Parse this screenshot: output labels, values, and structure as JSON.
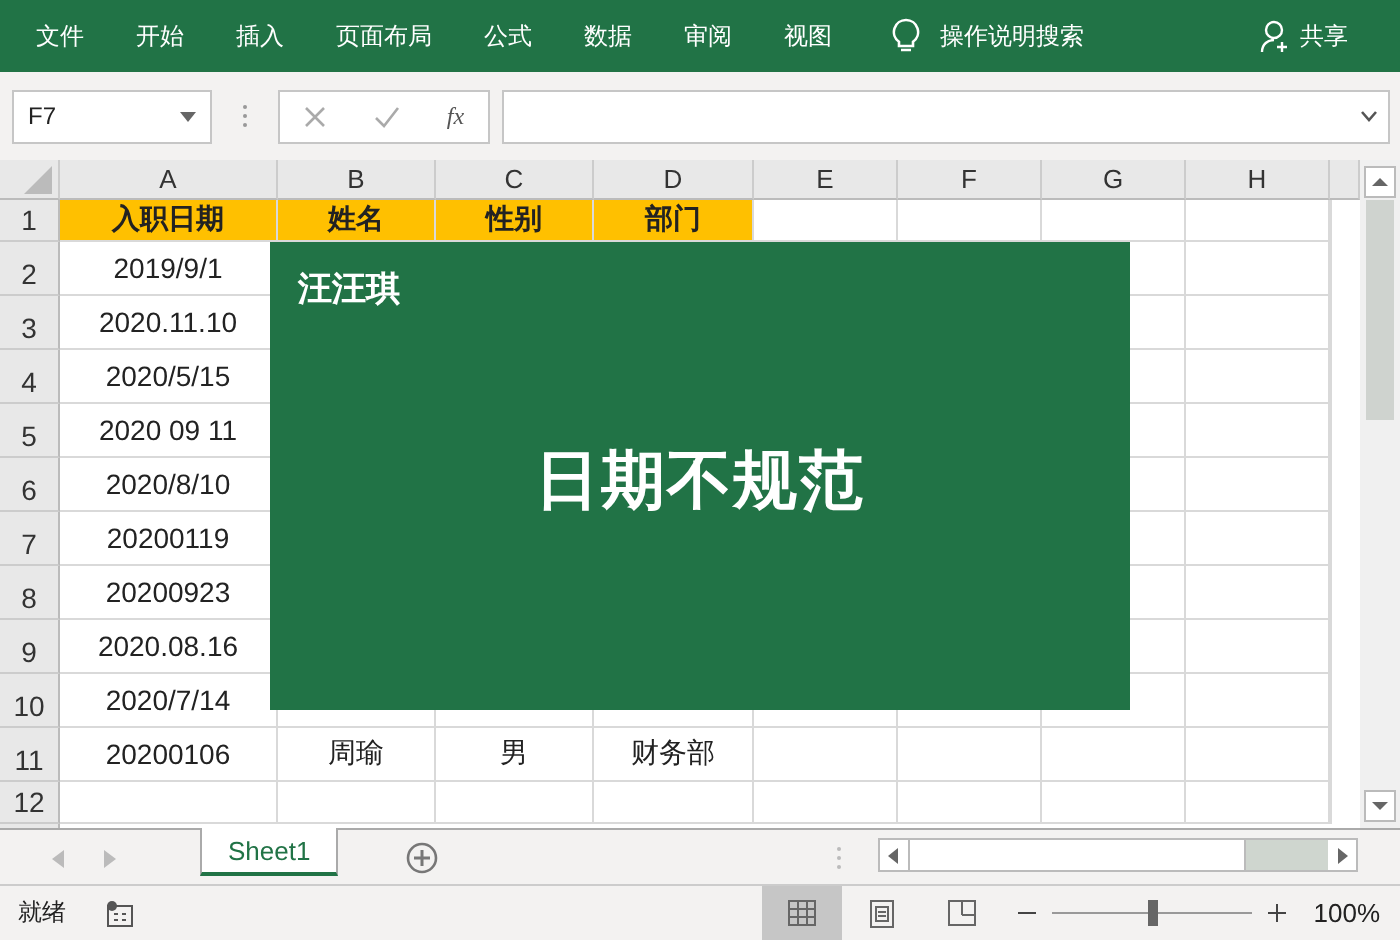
{
  "ribbon": {
    "tabs": [
      "文件",
      "开始",
      "插入",
      "页面布局",
      "公式",
      "数据",
      "审阅",
      "视图"
    ],
    "search_hint": "操作说明搜索",
    "share": "共享"
  },
  "formula_bar": {
    "name_box": "F7",
    "function_label": "fx"
  },
  "sheet": {
    "columns": [
      "A",
      "B",
      "C",
      "D",
      "E",
      "F",
      "G",
      "H"
    ],
    "rows": [
      {
        "number": "1",
        "kind": "header",
        "cells": [
          "入职日期",
          "姓名",
          "性别",
          "部门"
        ]
      },
      {
        "number": "2",
        "kind": "data",
        "cells": [
          "2019/9/1"
        ]
      },
      {
        "number": "3",
        "kind": "data",
        "cells": [
          "2020.11.10"
        ]
      },
      {
        "number": "4",
        "kind": "data",
        "cells": [
          "2020/5/15"
        ]
      },
      {
        "number": "5",
        "kind": "data",
        "cells": [
          "2020 09 11"
        ]
      },
      {
        "number": "6",
        "kind": "data",
        "cells": [
          "2020/8/10"
        ]
      },
      {
        "number": "7",
        "kind": "data",
        "cells": [
          "20200119"
        ]
      },
      {
        "number": "8",
        "kind": "data",
        "cells": [
          "20200923"
        ]
      },
      {
        "number": "9",
        "kind": "data",
        "cells": [
          "2020.08.16"
        ]
      },
      {
        "number": "10",
        "kind": "data",
        "cells": [
          "2020/7/14"
        ]
      },
      {
        "number": "11",
        "kind": "data",
        "cells": [
          "20200106",
          "周瑜",
          "男",
          "财务部"
        ]
      },
      {
        "number": "12",
        "kind": "data",
        "cells": []
      }
    ]
  },
  "overlay": {
    "author": "汪汪琪",
    "caption": "日期不规范"
  },
  "sheet_tabs": [
    {
      "label": "Sheet1",
      "selected": true
    }
  ],
  "status_bar": {
    "status": "就绪",
    "views": [
      {
        "kind": "normal",
        "selected": true
      },
      {
        "kind": "page_layout",
        "selected": false
      },
      {
        "kind": "page_break",
        "selected": false
      }
    ],
    "zoom": {
      "level": 0.5,
      "reading": "100%"
    }
  }
}
